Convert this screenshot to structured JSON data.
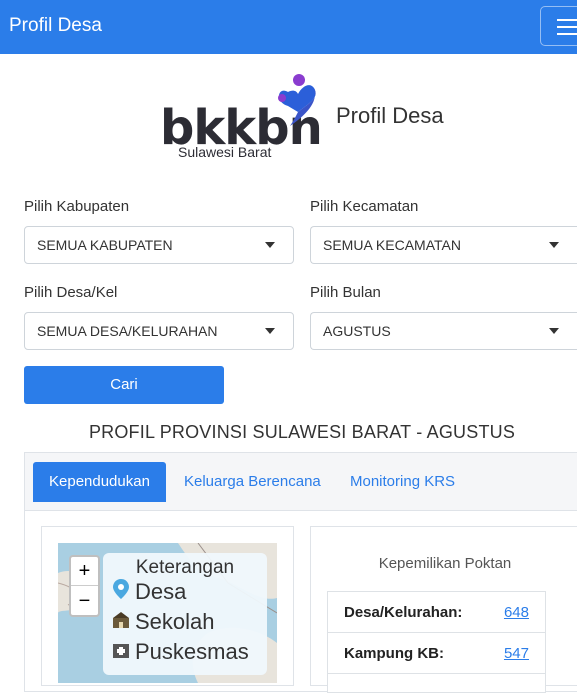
{
  "navbar": {
    "brand": "Profil Desa",
    "menu_icon": "hamburger-icon"
  },
  "logo": {
    "wordmark": "bkkbn",
    "subtitle": "Sulawesi Barat",
    "title": "Profil Desa",
    "colors": {
      "dark": "#2c2c34",
      "blue": "#2b5fd9",
      "purple": "#8a3ccf"
    }
  },
  "filters": {
    "kabupaten": {
      "label": "Pilih Kabupaten",
      "value": "SEMUA KABUPATEN"
    },
    "kecamatan": {
      "label": "Pilih Kecamatan",
      "value": "SEMUA KECAMATAN"
    },
    "desa": {
      "label": "Pilih Desa/Kel",
      "value": "SEMUA DESA/KELURAHAN"
    },
    "bulan": {
      "label": "Pilih Bulan",
      "value": "AGUSTUS"
    },
    "submit_label": "Cari"
  },
  "section_title": "PROFIL PROVINSI SULAWESI BARAT - AGUSTUS",
  "tabs": [
    {
      "label": "Kependudukan",
      "active": true
    },
    {
      "label": "Keluarga Berencana",
      "active": false
    },
    {
      "label": "Monitoring KRS",
      "active": false
    }
  ],
  "map": {
    "zoom_in": "+",
    "zoom_out": "−",
    "legend": {
      "title": "Keterangan",
      "items": [
        {
          "icon": "map-pin-icon",
          "label": "Desa"
        },
        {
          "icon": "school-icon",
          "label": "Sekolah"
        },
        {
          "icon": "hospital-icon",
          "label": "Puskesmas"
        }
      ]
    }
  },
  "stats": {
    "title": "Kepemilikan Poktan",
    "rows": [
      {
        "label": "Desa/Kelurahan:",
        "value": "648"
      },
      {
        "label": "Kampung KB:",
        "value": "547"
      }
    ]
  },
  "colors": {
    "primary": "#2b7de9",
    "map_water": "#a9cfe2",
    "map_land": "#e8e4dc"
  }
}
